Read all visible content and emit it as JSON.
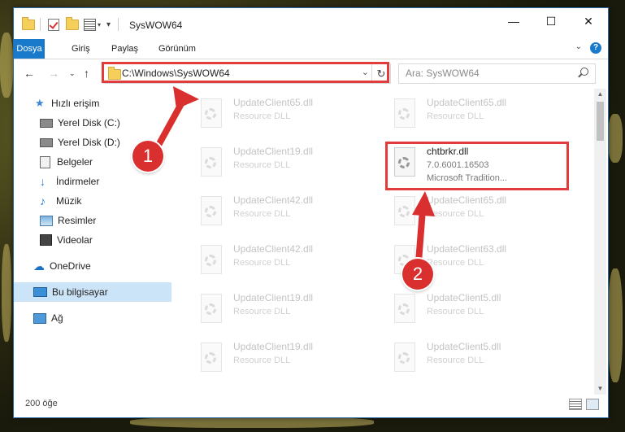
{
  "window": {
    "title": "SysWOW64",
    "controls": {
      "minimize": "—",
      "maximize": "☐",
      "close": "✕"
    }
  },
  "ribbon": {
    "tabs": [
      "Dosya",
      "Giriş",
      "Paylaş",
      "Görünüm"
    ],
    "active_tab": "Dosya",
    "help": "?"
  },
  "nav": {
    "address": "C:\\Windows\\SysWOW64",
    "search_placeholder": "Ara: SysWOW64"
  },
  "sidebar": {
    "items": [
      {
        "label": "Hızlı erişim",
        "icon": "star-icon"
      },
      {
        "label": "Yerel Disk (C:)",
        "icon": "drive-icon",
        "pinned": true
      },
      {
        "label": "Yerel Disk (D:)",
        "icon": "drive-icon",
        "pinned": true
      },
      {
        "label": "Belgeler",
        "icon": "documents-icon",
        "pinned": true
      },
      {
        "label": "İndirmeler",
        "icon": "download-icon",
        "pinned": true
      },
      {
        "label": "Müzik",
        "icon": "music-icon",
        "pinned": true
      },
      {
        "label": "Resimler",
        "icon": "pictures-icon",
        "pinned": true
      },
      {
        "label": "Videolar",
        "icon": "videos-icon",
        "pinned": true
      },
      {
        "label": "OneDrive",
        "icon": "cloud-icon"
      },
      {
        "label": "Bu bilgisayar",
        "icon": "computer-icon",
        "selected": true
      },
      {
        "label": "Ağ",
        "icon": "network-icon"
      }
    ]
  },
  "files": [
    {
      "name": "UpdateClient65.dll",
      "sub1": "Resource DLL"
    },
    {
      "name": "UpdateClient65.dll",
      "sub1": "Resource DLL"
    },
    {
      "name": "UpdateClient19.dll",
      "sub1": "Resource DLL"
    },
    {
      "name": "chtbrkr.dll",
      "sub1": "7.0.6001.16503",
      "sub2": "Microsoft Tradition..."
    },
    {
      "name": "UpdateClient42.dll",
      "sub1": "Resource DLL"
    },
    {
      "name": "UpdateClient65.dll",
      "sub1": "Resource DLL"
    },
    {
      "name": "UpdateClient42.dll",
      "sub1": "Resource DLL"
    },
    {
      "name": "UpdateClient63.dll",
      "sub1": "Resource DLL"
    },
    {
      "name": "UpdateClient19.dll",
      "sub1": "Resource DLL"
    },
    {
      "name": "UpdateClient5.dll",
      "sub1": "Resource DLL"
    },
    {
      "name": "UpdateClient19.dll",
      "sub1": "Resource DLL"
    },
    {
      "name": "UpdateClient5.dll",
      "sub1": "Resource DLL"
    }
  ],
  "status": {
    "count": "200 öğe"
  },
  "annotations": {
    "step1": "1",
    "step2": "2",
    "highlight_color": "#e23b3b"
  }
}
